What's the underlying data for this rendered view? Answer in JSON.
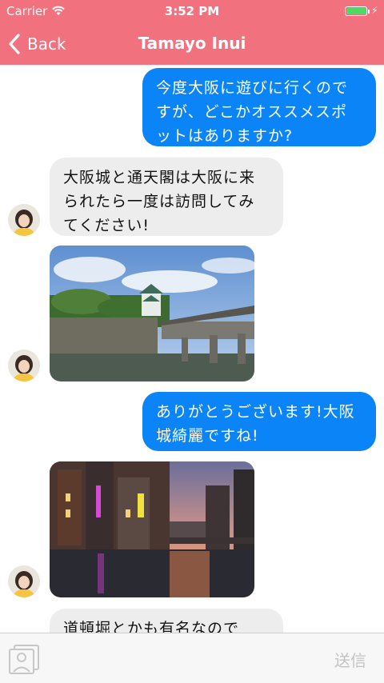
{
  "status_bar": {
    "carrier": "Carrier",
    "time": "3:52 PM"
  },
  "nav": {
    "back_label": "Back",
    "title": "Tamayo Inui"
  },
  "messages": [
    {
      "text": "今度大阪に遊びに行くのですが、どこかオススメスポットはありますか?"
    },
    {
      "text": "大阪城と通天閣は大阪に来られたら一度は訪問してみてください!"
    },
    {
      "text": "ありがとうございます!大阪城綺麗ですね!"
    },
    {
      "text": "道頓堀とかも有名なので"
    }
  ],
  "icons": [
    "wifi-icon",
    "battery-icon",
    "back-chevron-icon",
    "photo-library-icon"
  ],
  "input": {
    "send_label": "送信"
  },
  "colors": {
    "accent": "#f2717f",
    "outgoing": "#0a84f7",
    "incoming": "#ededed"
  }
}
